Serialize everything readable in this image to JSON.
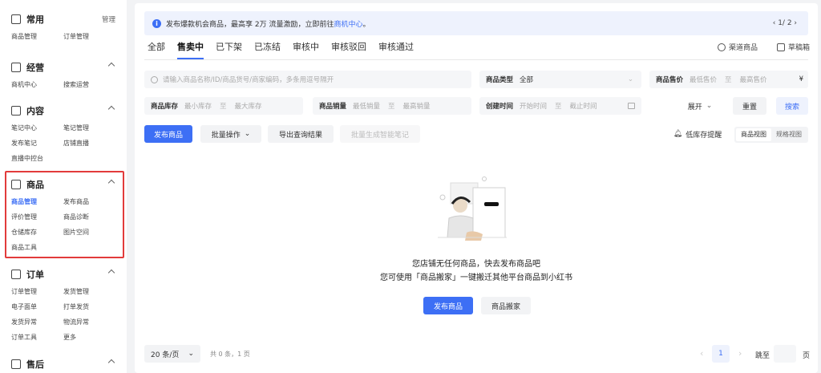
{
  "sidebar": {
    "sections": [
      {
        "title": "常用",
        "icon": "flag-icon",
        "right": "管理",
        "items": [
          "商品管理",
          "订单管理"
        ]
      },
      {
        "title": "经营",
        "icon": "trend-chart-icon",
        "items": [
          "商机中心",
          "搜索运营"
        ]
      },
      {
        "title": "内容",
        "icon": "book-icon",
        "items": [
          "笔记中心",
          "笔记管理",
          "发布笔记",
          "店铺直播",
          "直播中控台"
        ]
      },
      {
        "title": "商品",
        "icon": "bag-icon",
        "items": [
          "商品管理",
          "发布商品",
          "评价管理",
          "商品诊断",
          "仓储库存",
          "图片空间",
          "商品工具"
        ],
        "active": 0
      },
      {
        "title": "订单",
        "icon": "order-list-icon",
        "items": [
          "订单管理",
          "发货管理",
          "电子面单",
          "打单发货",
          "发货异常",
          "物流异常",
          "订单工具",
          "更多"
        ]
      },
      {
        "title": "售后",
        "icon": "after-sale-icon",
        "items": []
      }
    ]
  },
  "notice": {
    "text": "发布爆款机会商品，最高享 2万 流量激励，立即前往",
    "link": "商机中心",
    "tail": "。",
    "page": "‹ 1/ 2 ›"
  },
  "tabs": [
    "全部",
    "售卖中",
    "已下架",
    "已冻结",
    "审核中",
    "审核驳回",
    "审核通过"
  ],
  "active_tab": 1,
  "tab_right": {
    "channel": "渠道商品",
    "draft": "草稿箱"
  },
  "filters": {
    "search_placeholder": "请输入商品名称/ID/商品货号/商家编码，多条用逗号隔开",
    "type_label": "商品类型",
    "type_value": "全部",
    "price_label": "商品售价",
    "price_min": "最低售价",
    "price_to": "至",
    "price_max": "最高售价",
    "price_unit": "¥",
    "stock_label": "商品库存",
    "stock_min": "最小库存",
    "stock_to": "至",
    "stock_max": "最大库存",
    "sales_label": "商品销量",
    "sales_min": "最低销量",
    "sales_to": "至",
    "sales_max": "最高销量",
    "time_label": "创建时间",
    "time_start": "开始时间",
    "time_to": "至",
    "time_end": "截止时间",
    "expand": "展开",
    "reset": "重置",
    "search": "搜索"
  },
  "actions": {
    "publish": "发布商品",
    "batch": "批量操作",
    "export": "导出查询结果",
    "gen_note": "批量生成智能笔记",
    "low_stock": "低库存提醒",
    "view_goods": "商品视图",
    "view_spec": "规格视图"
  },
  "empty": {
    "line1": "您店铺无任何商品，快去发布商品吧",
    "line2": "您可使用「商品搬家」一键搬迁其他平台商品到小红书",
    "publish": "发布商品",
    "move": "商品搬家"
  },
  "pagination": {
    "page_size": "20 条/页",
    "total": "共 0 条，1 页",
    "current": "1",
    "jump_label": "跳至",
    "page_suffix": "页"
  },
  "colors": {
    "accent": "#3d6ff5",
    "highlight_box": "#e23b3b"
  }
}
